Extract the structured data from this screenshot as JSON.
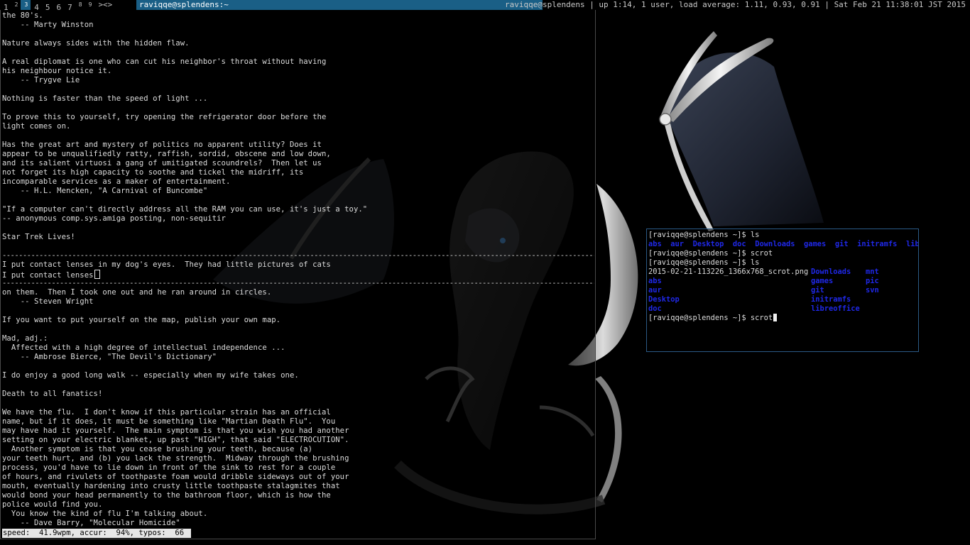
{
  "topbar": {
    "workspaces": [
      {
        "num": "1",
        "sup": ""
      },
      {
        "num": "",
        "sup": "2"
      },
      {
        "num": "",
        "sup": "3"
      },
      {
        "num": "4",
        "sup": ""
      },
      {
        "num": "5",
        "sup": ""
      },
      {
        "num": "6",
        "sup": ""
      },
      {
        "num": "7",
        "sup": ""
      },
      {
        "num": "",
        "sup": "8"
      },
      {
        "num": "",
        "sup": "9"
      }
    ],
    "active_workspace": 2,
    "layout_symbol": "><>",
    "window_title": "raviqqe@splendens:~",
    "status": "raviqqe@splendens | up 1:14, 1 user, load average: 1.11, 0.93, 0.91 | Sat Feb 21 11:38:01 JST 2015"
  },
  "left_terminal": {
    "lines_before": [
      "the 80's.",
      "    -- Marty Winston",
      "",
      "Nature always sides with the hidden flaw.",
      "",
      "A real diplomat is one who can cut his neighbor's throat without having",
      "his neighbour notice it.",
      "    -- Trygve Lie",
      "",
      "Nothing is faster than the speed of light ...",
      "",
      "To prove this to yourself, try opening the refrigerator door before the",
      "light comes on.",
      "",
      "Has the great art and mystery of politics no apparent utility? Does it",
      "appear to be unqualifiedly ratty, raffish, sordid, obscene and low down,",
      "and its salient virtuosi a gang of umitigated scoundrels?  Then let us",
      "not forget its high capacity to soothe and tickel the midriff, its",
      "incomparable services as a maker of entertainment.",
      "    -- H.L. Mencken, \"A Carnival of Buncombe\"",
      "",
      "\"If a computer can't directly address all the RAM you can use, it's just a toy.\"",
      "-- anonymous comp.sys.amiga posting, non-sequitir",
      "",
      "Star Trek Lives!",
      ""
    ],
    "divider": "------------------------------------------------------------------------------------------------------------------------------------------------------------------",
    "typing_target": "I put contact lenses in my dog's eyes.  They had little pictures of cats",
    "typing_input": "I put contact lenses",
    "lines_after": [
      "on them.  Then I took one out and he ran around in circles.",
      "    -- Steven Wright",
      "",
      "If you want to put yourself on the map, publish your own map.",
      "",
      "Mad, adj.:",
      "  Affected with a high degree of intellectual independence ...",
      "    -- Ambrose Bierce, \"The Devil's Dictionary\"",
      "",
      "I do enjoy a good long walk -- especially when my wife takes one.",
      "",
      "Death to all fanatics!",
      "",
      "We have the flu.  I don't know if this particular strain has an official",
      "name, but if it does, it must be something like \"Martian Death Flu\".  You",
      "may have had it yourself.  The main symptom is that you wish you had another",
      "setting on your electric blanket, up past \"HIGH\", that said \"ELECTROCUTION\".",
      "  Another symptom is that you cease brushing your teeth, because (a)",
      "your teeth hurt, and (b) you lack the strength.  Midway through the brushing",
      "process, you'd have to lie down in front of the sink to rest for a couple",
      "of hours, and rivulets of toothpaste foam would dribble sideways out of your",
      "mouth, eventually hardening into crusty little toothpaste stalagmites that",
      "would bond your head permanently to the bathroom floor, which is how the",
      "police would find you.",
      "  You know the kind of flu I'm talking about.",
      "    -- Dave Barry, \"Molecular Homicide\""
    ],
    "stats": "speed:  41.9wpm, accur:  94%, typos:  66 "
  },
  "right_terminal": {
    "prompt": "[raviqqe@splendens ~]$ ",
    "cmd1": "ls",
    "ls1_dirs": [
      "abs",
      "aur",
      "Desktop",
      "doc",
      "Downloads",
      "games",
      "git",
      "initramfs",
      "libre"
    ],
    "cmd2": "scrot",
    "cmd3": "ls",
    "ls2_rows": [
      {
        "c1": "2015-02-21-113226_1366x768_scrot.png",
        "c1dir": false,
        "c2": "Downloads",
        "c3": "mnt"
      },
      {
        "c1": "abs",
        "c1dir": true,
        "c2": "games",
        "c3": "pic"
      },
      {
        "c1": "aur",
        "c1dir": true,
        "c2": "git",
        "c3": "svn"
      },
      {
        "c1": "Desktop",
        "c1dir": true,
        "c2": "initramfs",
        "c3": ""
      },
      {
        "c1": "doc",
        "c1dir": true,
        "c2": "libreoffice",
        "c3": ""
      }
    ],
    "cmd4": "scrot"
  },
  "colors": {
    "bar_accent": "#1a5f86",
    "dir_blue": "#1f28e8",
    "terminal_border": "#2b5a86"
  }
}
